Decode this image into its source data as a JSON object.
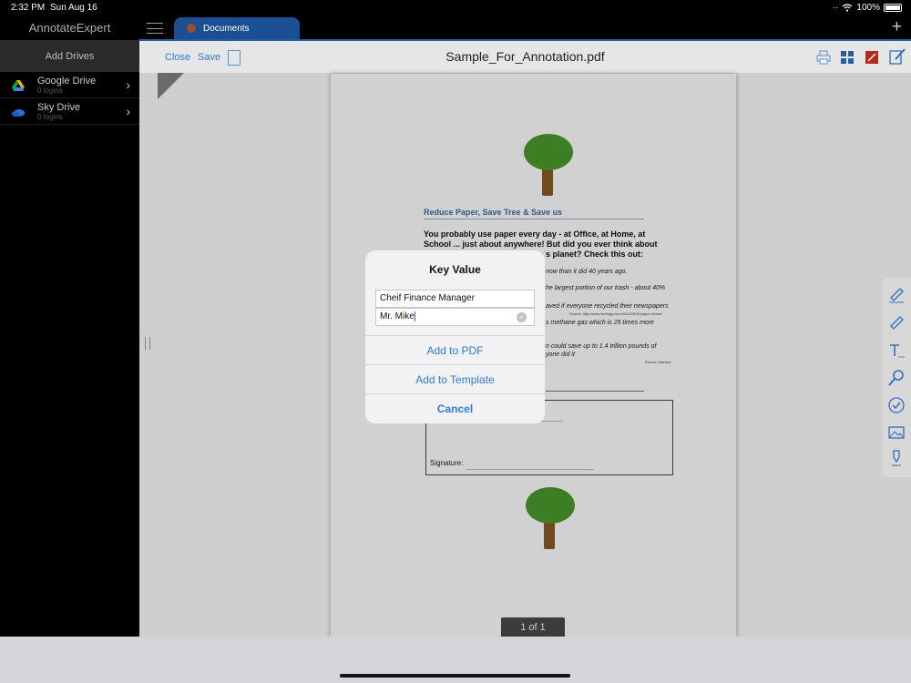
{
  "status": {
    "time": "2:32 PM",
    "date": "Sun Aug 16",
    "battery": "100%"
  },
  "sidebar": {
    "app_title": "AnnotateExpert",
    "add_drives": "Add Drives",
    "drives": [
      {
        "name": "Google Drive",
        "sub": "0 logins",
        "icon": "google-drive-icon"
      },
      {
        "name": "Sky Drive",
        "sub": "0 logins",
        "icon": "sky-drive-icon"
      }
    ]
  },
  "tabs": {
    "active": "Documents"
  },
  "toolbar": {
    "close": "Close",
    "save": "Save",
    "filename": "Sample_For_Annotation.pdf"
  },
  "document": {
    "heading": "Reduce Paper, Save Tree & Save us",
    "intro": "You probably use paper every day - at Office, at Home, at School ... just about anywhere! But did you ever think about",
    "intro_end": "s planet? Check this out:",
    "facts": [
      "now than it did 40 years ago.",
      "he largest portion of our trash - about 40%",
      "aved if everyone recycled their newspapers",
      "s methane gas which is 25 times more",
      "n could save up to 1.4 trillion pounds of",
      "yone did it"
    ],
    "source1": "Source: http://www.ecology.com/2011/09/10/paper-chase/",
    "source2": "Source: Internet",
    "signature_label": "Signature:",
    "page_indicator": "1 of 1"
  },
  "dialog": {
    "title": "Key Value",
    "field_key": "Cheif Finance Manager",
    "field_value": "Mr. Mike",
    "add_pdf": "Add to PDF",
    "add_template": "Add to Template",
    "cancel": "Cancel"
  },
  "colors": {
    "accent": "#2c7bd6",
    "tab": "#1a4f93"
  }
}
